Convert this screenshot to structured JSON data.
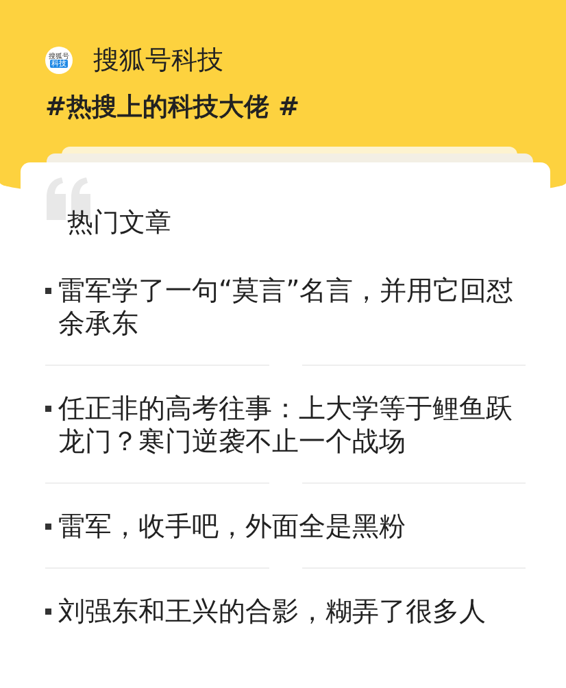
{
  "account": {
    "logo": {
      "top": "搜狐号",
      "bottom": "科技"
    },
    "name": "搜狐号科技"
  },
  "topic": "#热搜上的科技大佬 #",
  "section_title": "热门文章",
  "articles": [
    {
      "title": "雷军学了一句“莫言”名言，并用它回怼余承东"
    },
    {
      "title": "任正非的高考往事：上大学等于鲤鱼跃龙门？寒门逆袭不止一个战场"
    },
    {
      "title": "雷军，收手吧，外面全是黑粉"
    },
    {
      "title": "刘强东和王兴的合影，糊弄了很多人"
    }
  ]
}
